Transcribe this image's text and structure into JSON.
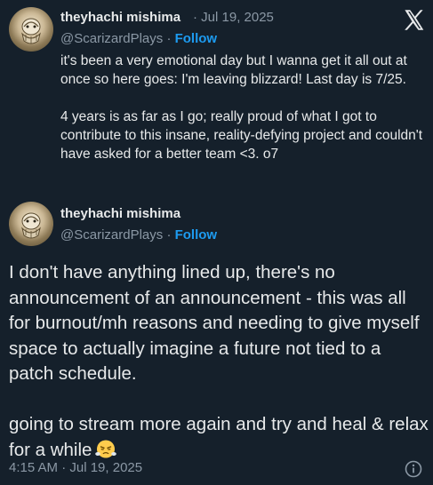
{
  "quoted_tweet": {
    "author_name": "theyhachi mishima",
    "separator": "·",
    "date": "Jul 19, 2025",
    "handle": "@ScarizardPlays",
    "follow_label": "Follow",
    "paragraphs": [
      "it's been a very emotional day but I wanna get it all out at once so here goes: I'm leaving blizzard! Last day is 7/25.",
      "4 years is as far as I go; really proud of what I got to contribute to this insane, reality-defying project and couldn't have asked for a better team <3. o7"
    ]
  },
  "main_tweet": {
    "author_name": "theyhachi mishima",
    "handle": "@ScarizardPlays",
    "separator": "·",
    "follow_label": "Follow",
    "paragraphs": [
      "I don't have anything lined up, there's no announcement of an announcement - this was all for burnout/mh reasons and needing to give myself space to actually imagine a future not tied to a patch schedule.",
      "going to stream more again and try and heal & relax for a while"
    ],
    "emoji": "face-with-steam-emoji",
    "timestamp": "4:15 AM · Jul 19, 2025"
  },
  "icons": {
    "x_logo": "x-logo-icon",
    "info": "info-icon"
  }
}
